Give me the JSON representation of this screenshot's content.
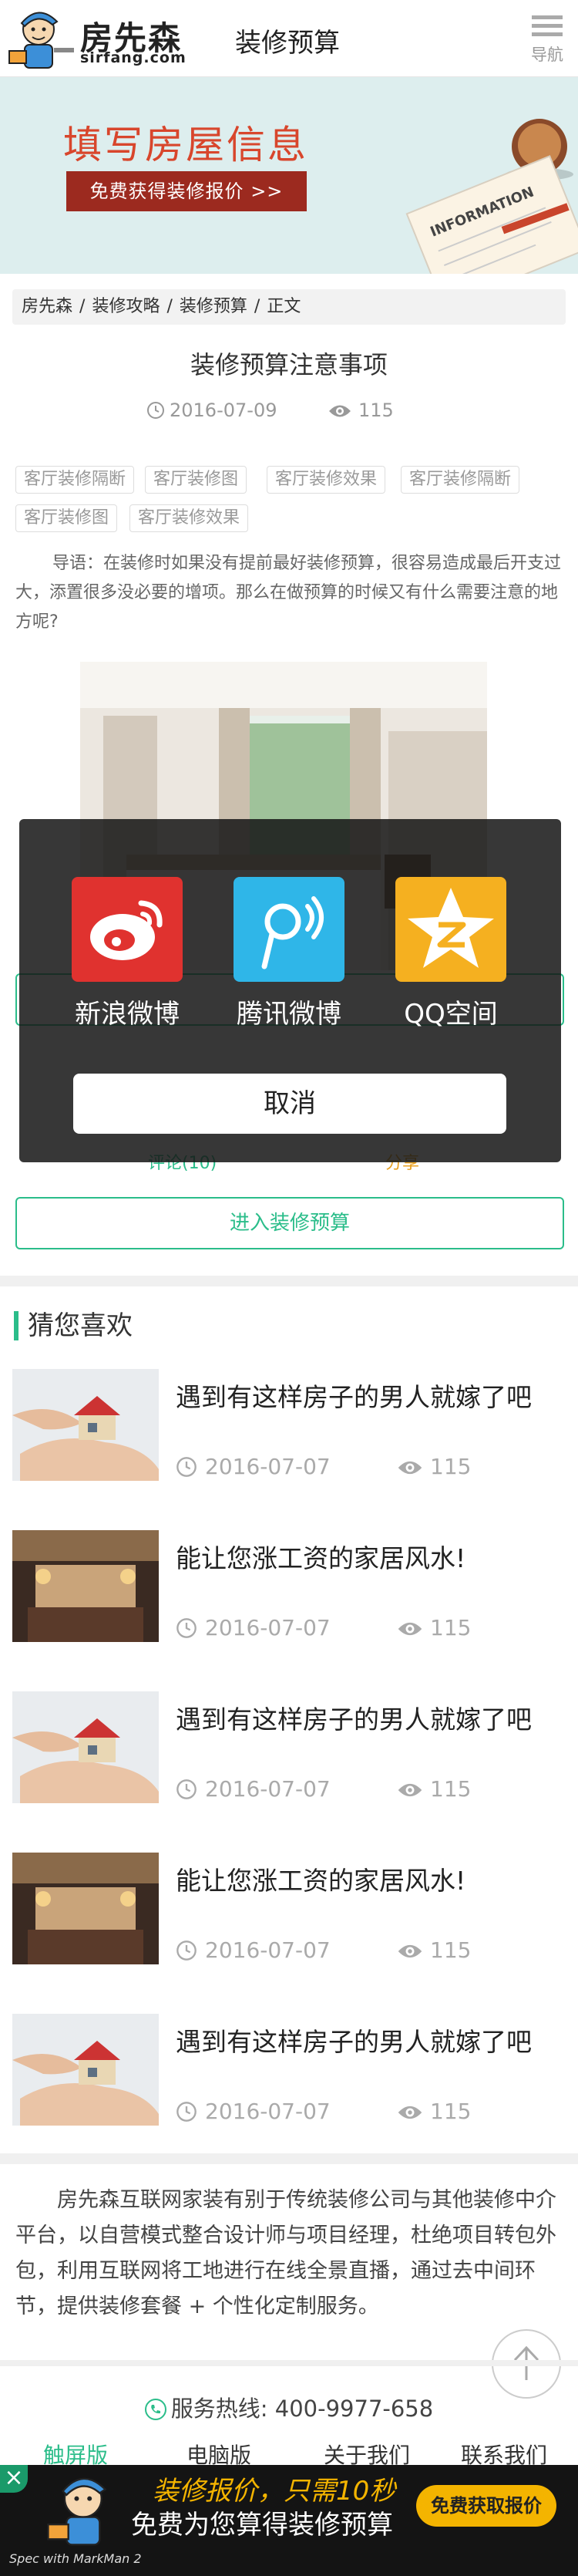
{
  "header": {
    "logo_cn": "房先森",
    "logo_en": "sirfang.com",
    "title": "装修预算",
    "menu_label": "导航"
  },
  "banner": {
    "title": "填写房屋信息",
    "button": "免费获得装修报价 >>",
    "slide_count": 2,
    "active_slide": 1
  },
  "breadcrumb": [
    "房先森",
    "/",
    "装修攻略",
    "/",
    "装修预算",
    "/",
    "正文"
  ],
  "article": {
    "title": "装修预算注意事项",
    "date": "2016-07-09",
    "views": "115",
    "tags": [
      "客厅装修隔断",
      "客厅装修图",
      "客厅装修效果",
      "客厅装修隔断",
      "客厅装修图",
      "客厅装修效果"
    ],
    "intro": "导语：在装修时如果没有提前最好装修预算，很容易造成最后开支过大，添置很多没必要的增项。那么在做预算的时候又有什么需要注意的地方呢?",
    "stat_left": "评论(10)",
    "stat_right": "分享"
  },
  "share": {
    "items": [
      {
        "label": "新浪微博",
        "icon": "weibo-icon",
        "color": "#e0322f"
      },
      {
        "label": "腾讯微博",
        "icon": "tencent-weibo-icon",
        "color": "#2fb6e8"
      },
      {
        "label": "QQ空间",
        "icon": "qzone-icon",
        "color": "#f5b020"
      }
    ],
    "cancel": "取消"
  },
  "enter_button": "进入装修预算",
  "recommend": {
    "title": "猜您喜欢",
    "items": [
      {
        "title": "遇到有这样房子的男人就嫁了吧",
        "date": "2016-07-07",
        "views": "115",
        "thumb": "house-in-hands"
      },
      {
        "title": "能让您涨工资的家居风水!",
        "date": "2016-07-07",
        "views": "115",
        "thumb": "interior-room"
      },
      {
        "title": "遇到有这样房子的男人就嫁了吧",
        "date": "2016-07-07",
        "views": "115",
        "thumb": "house-in-hands"
      },
      {
        "title": "能让您涨工资的家居风水!",
        "date": "2016-07-07",
        "views": "115",
        "thumb": "interior-room"
      },
      {
        "title": "遇到有这样房子的男人就嫁了吧",
        "date": "2016-07-07",
        "views": "115",
        "thumb": "house-in-hands"
      }
    ]
  },
  "about": "房先森互联网家装有别于传统装修公司与其他装修中介平台，以自营模式整合设计师与项目经理，杜绝项目转包外包，利用互联网将工地进行在线全景直播，通过去中间环节，提供装修套餐 + 个性化定制服务。",
  "footer": {
    "hotline": "服务热线: 400-9977-658",
    "links": [
      "触屏版",
      "电脑版",
      "关于我们",
      "联系我们"
    ]
  },
  "promo": {
    "close": "×",
    "line1": "装修报价，只需10秒",
    "line2": "免费为您算得装修预算",
    "button": "免费获取报价",
    "credit": "Spec with MarkMan 2"
  },
  "colors": {
    "accent": "#2bbd8a",
    "brand_red": "#9c2a1f",
    "promo_yellow": "#f4b400"
  }
}
